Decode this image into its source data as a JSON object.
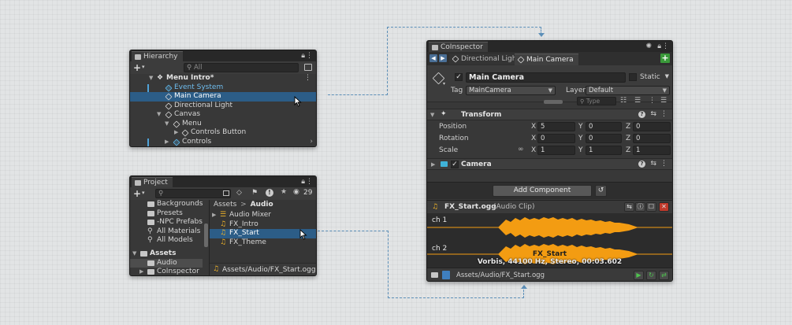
{
  "hierarchy": {
    "tab_title": "Hierarchy",
    "search_placeholder": "All",
    "items": [
      {
        "label": "Menu Intro*"
      },
      {
        "label": "Event System"
      },
      {
        "label": "Main Camera"
      },
      {
        "label": "Directional Light"
      },
      {
        "label": "Canvas"
      },
      {
        "label": "Menu"
      },
      {
        "label": "Controls Button"
      },
      {
        "label": "Controls"
      }
    ]
  },
  "project": {
    "tab_title": "Project",
    "hidden_count": "29",
    "tree": [
      {
        "label": "Backgrounds"
      },
      {
        "label": "Presets"
      },
      {
        "label": "-NPC Prefabs"
      },
      {
        "label": "All Materials"
      },
      {
        "label": "All Models"
      },
      {
        "label": "Assets"
      },
      {
        "label": "Audio"
      },
      {
        "label": "CoInspector"
      }
    ],
    "breadcrumb": {
      "root": "Assets",
      "sep": ">",
      "current": "Audio"
    },
    "files": [
      {
        "label": "Audio Mixer"
      },
      {
        "label": "FX_Intro"
      },
      {
        "label": "FX_Start"
      },
      {
        "label": "FX_Theme"
      }
    ],
    "status_path": "Assets/Audio/FX_Start.ogg"
  },
  "inspector": {
    "tab_title": "CoInspector",
    "subtabs": [
      {
        "label": "Directional Light"
      },
      {
        "label": "Main Camera"
      }
    ],
    "object_name": "Main Camera",
    "static_label": "Static",
    "tag_label": "Tag",
    "tag_value": "MainCamera",
    "layer_label": "Layer",
    "layer_value": "Default",
    "type_placeholder": "Type",
    "transform": {
      "title": "Transform",
      "rows": [
        {
          "label": "Position",
          "x": "5",
          "y": "0",
          "z": "0"
        },
        {
          "label": "Rotation",
          "x": "0",
          "y": "0",
          "z": "0"
        },
        {
          "label": "Scale",
          "x": "1",
          "y": "1",
          "z": "1"
        }
      ],
      "axis_x": "X",
      "axis_y": "Y",
      "axis_z": "Z"
    },
    "camera_title": "Camera",
    "add_component": "Add Component",
    "audio": {
      "name": "FX_Start.ogg",
      "type": "(Audio Clip)",
      "ch1": "ch 1",
      "ch2": "ch 2",
      "overlay_name": "FX_Start",
      "overlay_info": "Vorbis, 44100 Hz, Stereo, 00:03.602"
    },
    "status_path": "Assets/Audio/FX_Start.ogg"
  },
  "colors": {
    "selection": "#2c5d87",
    "waveform": "#f39c12",
    "accent_green": "#3a9a3a",
    "close_red": "#c0392b",
    "connector": "#5c8fb8"
  }
}
